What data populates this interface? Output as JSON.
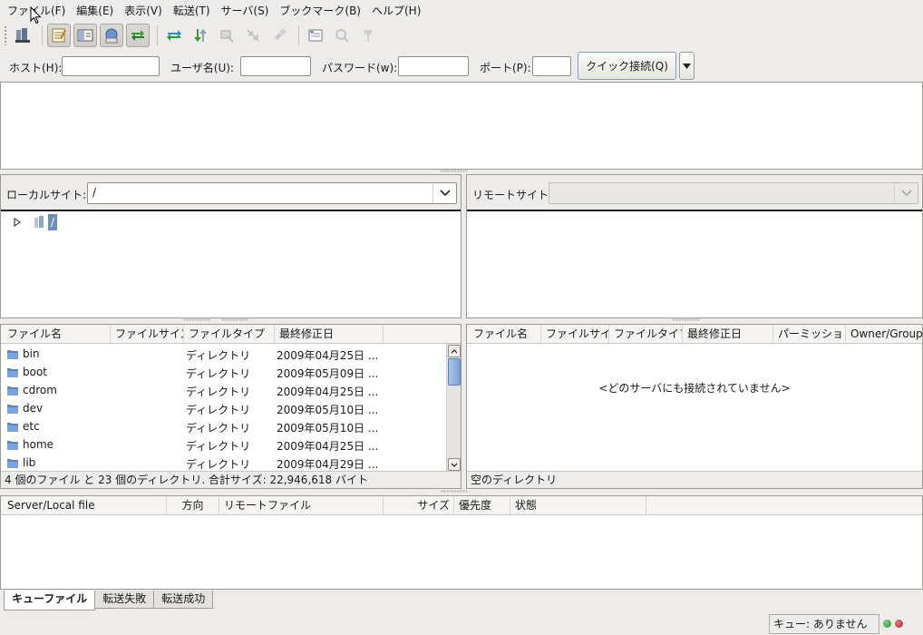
{
  "menu": [
    "ファイル(F)",
    "編集(E)",
    "表示(V)",
    "転送(T)",
    "サーバ(S)",
    "ブックマーク(B)",
    "ヘルプ(H)"
  ],
  "toolbar_icons": [
    "site-manager-icon",
    "message-log-icon",
    "local-tree-icon",
    "remote-tree-icon",
    "queue-icon",
    "refresh-icon",
    "process-queue-icon",
    "cancel-icon",
    "disconnect-icon",
    "reconnect-icon",
    "filter-icon",
    "compare-icon",
    "search-icon"
  ],
  "quickconnect": {
    "host_label": "ホスト(H):",
    "user_label": "ユーザ名(U):",
    "pass_label": "パスワード(w):",
    "port_label": "ポート(P):",
    "host_value": "",
    "user_value": "",
    "pass_value": "",
    "port_value": "",
    "button": "クイック接続(Q)"
  },
  "local": {
    "label": "ローカルサイト:",
    "path": "/",
    "tree_root": "/",
    "columns": [
      "ファイル名",
      "ファイルサイズ",
      "ファイルタイプ",
      "最終修正日"
    ],
    "rows": [
      {
        "name": "bin",
        "type": "ディレクトリ",
        "date": "2009年04月25日 ..."
      },
      {
        "name": "boot",
        "type": "ディレクトリ",
        "date": "2009年05月09日 ..."
      },
      {
        "name": "cdrom",
        "type": "ディレクトリ",
        "date": "2009年04月25日 ..."
      },
      {
        "name": "dev",
        "type": "ディレクトリ",
        "date": "2009年05月10日 ..."
      },
      {
        "name": "etc",
        "type": "ディレクトリ",
        "date": "2009年05月10日 ..."
      },
      {
        "name": "home",
        "type": "ディレクトリ",
        "date": "2009年04月25日 ..."
      },
      {
        "name": "lib",
        "type": "ディレクトリ",
        "date": "2009年04月29日 ..."
      }
    ],
    "status": "4 個のファイル と 23 個のディレクトリ. 合計サイズ: 22,946,618 バイト"
  },
  "remote": {
    "label": "リモートサイト:",
    "path": "",
    "columns": [
      "ファイル名",
      "ファイルサイズ",
      "ファイルタイプ",
      "最終修正日",
      "パーミッション",
      "Owner/Group"
    ],
    "empty_message": "<どのサーバにも接続されていません>",
    "status": "空のディレクトリ"
  },
  "queue": {
    "columns": [
      "Server/Local file",
      "方向",
      "リモートファイル",
      "サイズ",
      "優先度",
      "状態"
    ],
    "tabs": [
      "キューファイル",
      "転送失敗",
      "転送成功"
    ],
    "status": "キュー: ありません"
  },
  "colors": {
    "selection": "#6c8fbf",
    "folder": "#5b86c8",
    "led_green": "#2e8b2e",
    "led_red": "#a52a2a"
  }
}
